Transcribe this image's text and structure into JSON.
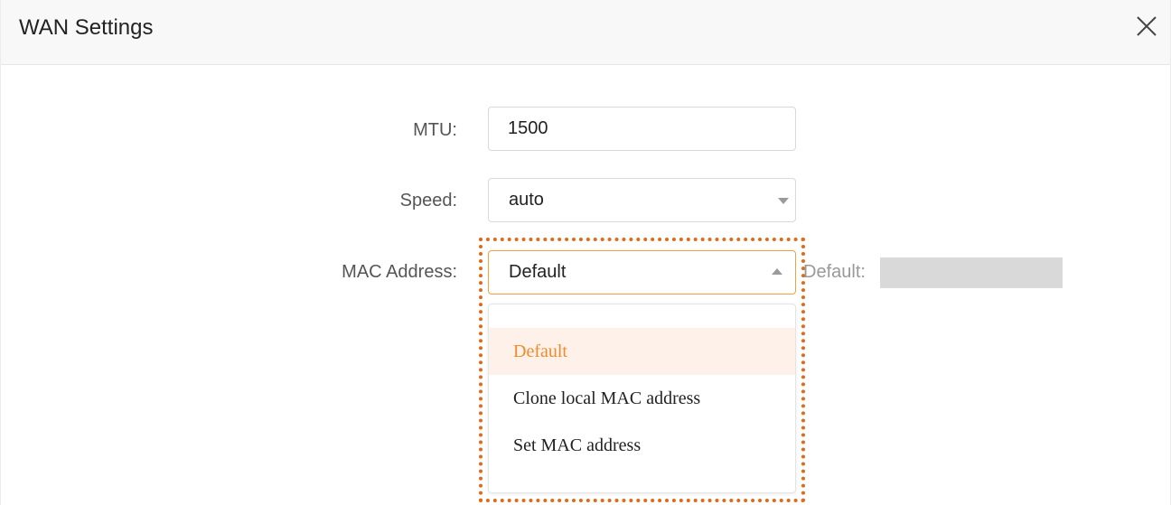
{
  "dialog": {
    "title": "WAN Settings",
    "close_icon": "close-icon"
  },
  "form": {
    "mtu": {
      "label": "MTU:",
      "value": "1500"
    },
    "speed": {
      "label": "Speed:",
      "value": "auto",
      "icon": "chevron-down-icon"
    },
    "mac": {
      "label": "MAC Address:",
      "value": "Default",
      "icon": "chevron-up-icon",
      "default_note": "Default:",
      "options": [
        "Default",
        "Clone local MAC address",
        "Set MAC address"
      ],
      "selected_index": 0
    }
  },
  "colors": {
    "accent": "#f08a2c",
    "highlight_border": "#e06a1a",
    "selected_bg": "#fdf1ea"
  }
}
